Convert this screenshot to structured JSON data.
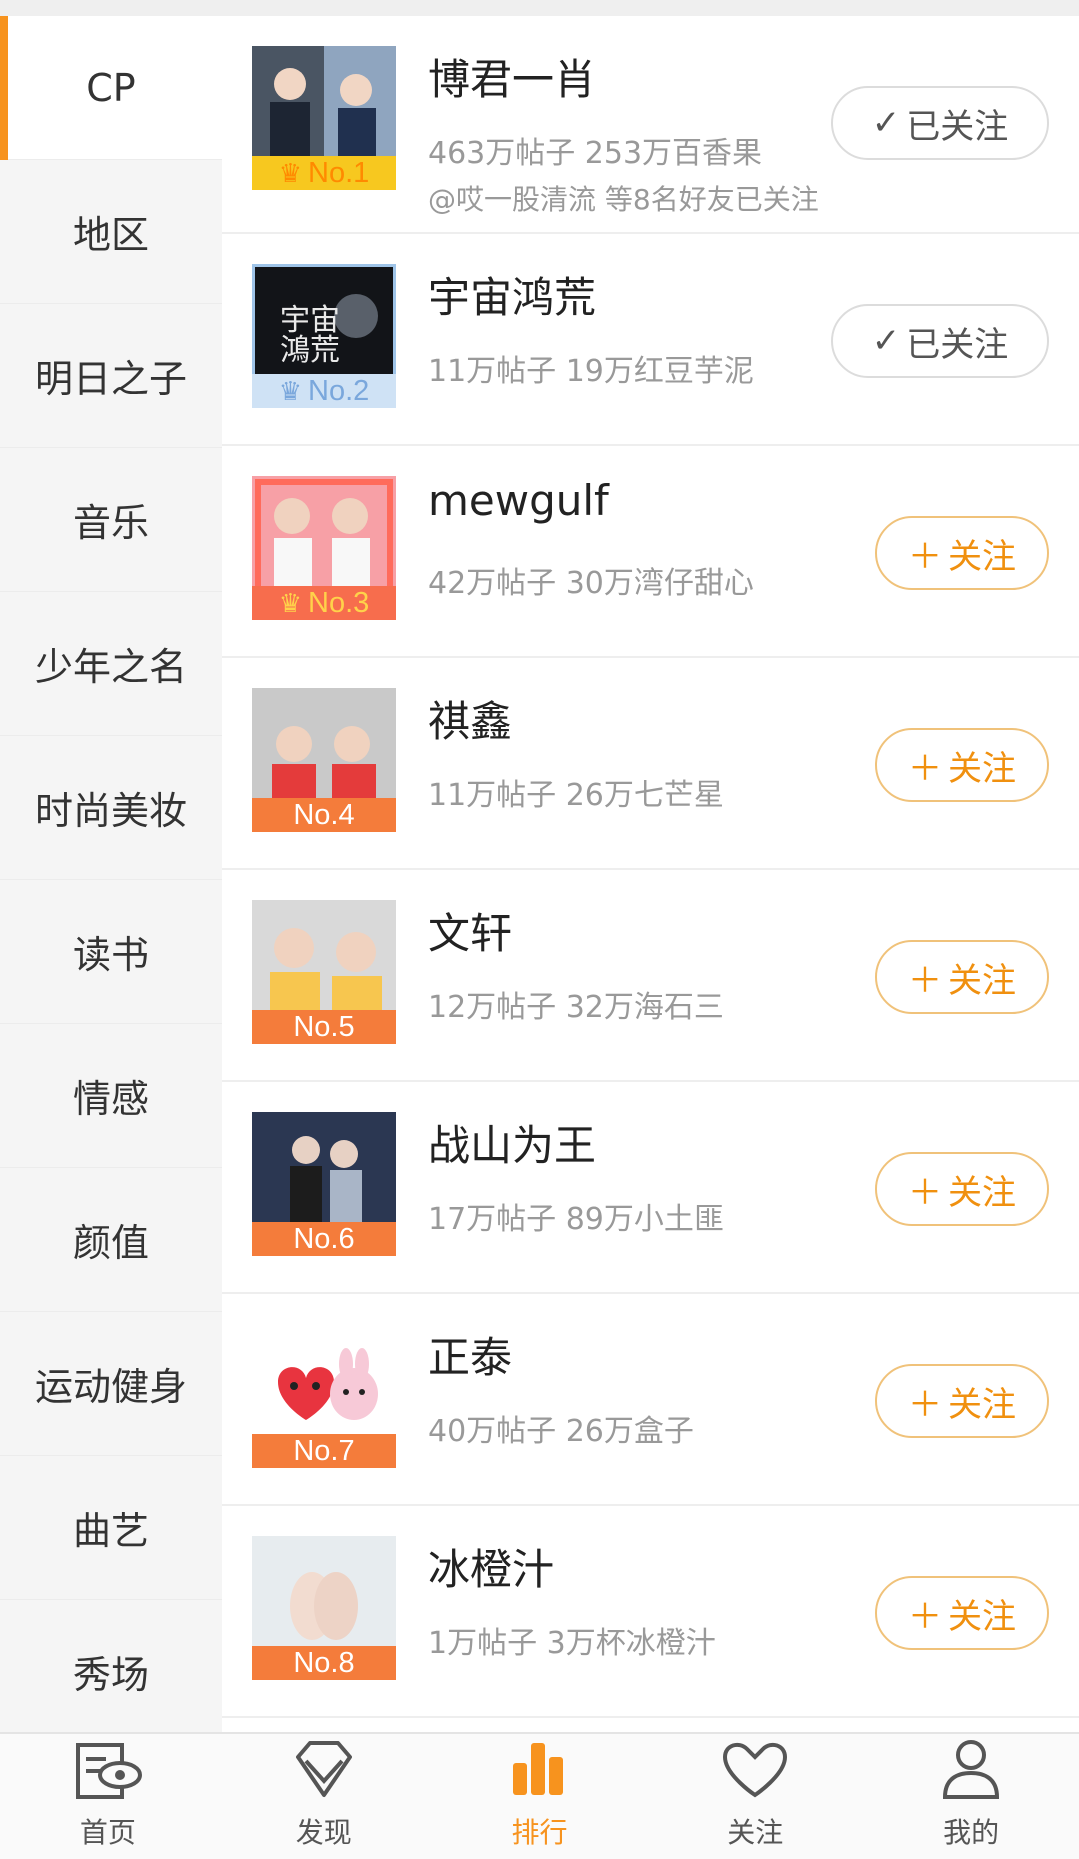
{
  "sidebar": {
    "items": [
      {
        "label": "CP"
      },
      {
        "label": "地区"
      },
      {
        "label": "明日之子"
      },
      {
        "label": "音乐"
      },
      {
        "label": "少年之名"
      },
      {
        "label": "时尚美妆"
      },
      {
        "label": "读书"
      },
      {
        "label": "情感"
      },
      {
        "label": "颜值"
      },
      {
        "label": "运动健身"
      },
      {
        "label": "曲艺"
      },
      {
        "label": "秀场"
      }
    ],
    "active_index": 0
  },
  "ranking": [
    {
      "rank": "No.1",
      "name": "博君一肖",
      "stats": "463万帖子 253万百香果",
      "friends": "@哎一股清流 等8名好友已关注",
      "button": "已关注",
      "followed": true
    },
    {
      "rank": "No.2",
      "name": "宇宙鸿荒",
      "stats": "11万帖子 19万红豆芋泥",
      "button": "已关注",
      "followed": true
    },
    {
      "rank": "No.3",
      "name": "mewgulf",
      "stats": "42万帖子 30万湾仔甜心",
      "button": "关注",
      "followed": false
    },
    {
      "rank": "No.4",
      "name": "祺鑫",
      "stats": "11万帖子 26万七芒星",
      "button": "关注",
      "followed": false
    },
    {
      "rank": "No.5",
      "name": "文轩",
      "stats": "12万帖子 32万海石三",
      "button": "关注",
      "followed": false
    },
    {
      "rank": "No.6",
      "name": "战山为王",
      "stats": "17万帖子 89万小土匪",
      "button": "关注",
      "followed": false
    },
    {
      "rank": "No.7",
      "name": "正泰",
      "stats": "40万帖子 26万盒子",
      "button": "关注",
      "followed": false
    },
    {
      "rank": "No.8",
      "name": "冰橙汁",
      "stats": "1万帖子 3万杯冰橙汁",
      "button": "关注",
      "followed": false
    }
  ],
  "icons": {
    "crown": "crown-icon",
    "check": "check-icon",
    "plus": "plus-icon"
  },
  "bottom_nav": [
    {
      "label": "首页",
      "icon": "home-icon"
    },
    {
      "label": "发现",
      "icon": "diamond-icon"
    },
    {
      "label": "排行",
      "icon": "ranking-icon",
      "active": true
    },
    {
      "label": "关注",
      "icon": "heart-icon"
    },
    {
      "label": "我的",
      "icon": "profile-icon"
    }
  ],
  "colors": {
    "accent": "#f7931e",
    "follow_border": "#f0c27a",
    "muted_text": "#999999"
  }
}
